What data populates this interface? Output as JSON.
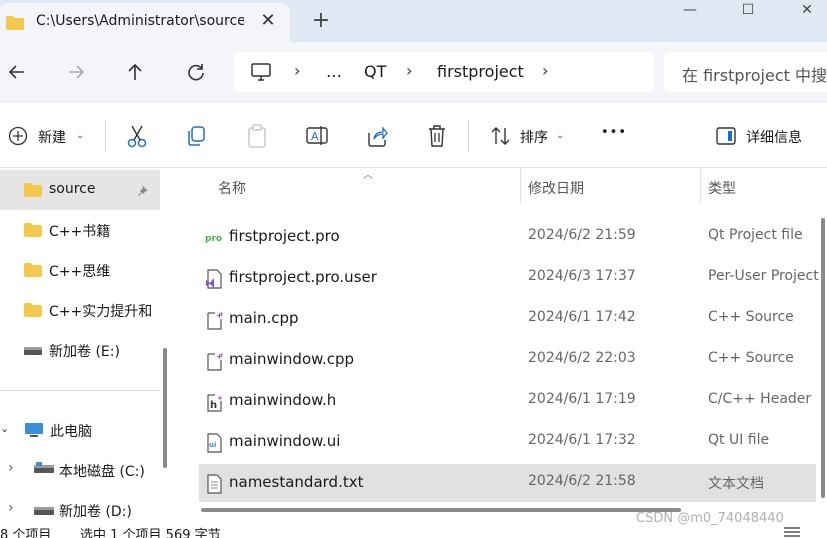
{
  "tab": {
    "title": "C:\\Users\\Administrator\\source",
    "close_glyph": "✕",
    "newtab_glyph": "+"
  },
  "window": {
    "minimize": "—",
    "maximize": "☐",
    "close": "✕"
  },
  "nav": {
    "back": "←",
    "forward": "→",
    "up": "↑",
    "refresh": "↻",
    "breadcrumbs": [
      "…",
      "QT",
      "firstproject"
    ],
    "search_placeholder": "在 firstproject 中搜"
  },
  "commands": {
    "new_label": "新建",
    "sort_label": "排序",
    "more": "•••",
    "details_label": "详细信息"
  },
  "sidebar": {
    "items": [
      {
        "label": "source",
        "icon": "folder-icon"
      },
      {
        "label": "C++书籍",
        "icon": "folder-icon"
      },
      {
        "label": "C++思维",
        "icon": "folder-icon"
      },
      {
        "label": "C++实力提升和",
        "icon": "folder-icon"
      },
      {
        "label": "新加卷 (E:)",
        "icon": "drive-icon"
      },
      {
        "label": "此电脑",
        "icon": "computer-icon"
      },
      {
        "label": "本地磁盘 (C:)",
        "icon": "drive-icon"
      },
      {
        "label": "新加卷 (D:)",
        "icon": "drive-icon"
      }
    ]
  },
  "columns": {
    "name": "名称",
    "date": "修改日期",
    "type": "类型"
  },
  "files": [
    {
      "name": "firstproject.pro",
      "date": "2024/6/2 21:59",
      "type": "Qt Project file",
      "icon": "pro-file-icon"
    },
    {
      "name": "firstproject.pro.user",
      "date": "2024/6/3 17:37",
      "type": "Per-User Project",
      "icon": "user-file-icon"
    },
    {
      "name": "main.cpp",
      "date": "2024/6/1 17:42",
      "type": "C++ Source",
      "icon": "cpp-file-icon"
    },
    {
      "name": "mainwindow.cpp",
      "date": "2024/6/2 22:03",
      "type": "C++ Source",
      "icon": "cpp-file-icon"
    },
    {
      "name": "mainwindow.h",
      "date": "2024/6/1 17:19",
      "type": "C/C++ Header",
      "icon": "header-file-icon"
    },
    {
      "name": "mainwindow.ui",
      "date": "2024/6/1 17:32",
      "type": "Qt UI file",
      "icon": "ui-file-icon"
    },
    {
      "name": "namestandard.txt",
      "date": "2024/6/2 21:58",
      "type": "文本文档",
      "icon": "txt-file-icon"
    }
  ],
  "status": {
    "count": "8 个项目",
    "selection": "选中 1 个项目  569 字节"
  },
  "watermark": "CSDN @m0_74048440",
  "colors": {
    "titlebar": "#dfe9f3",
    "folder": "#f2c94c",
    "selected_row": "#e1e1e1",
    "accent": "#0067c0"
  }
}
